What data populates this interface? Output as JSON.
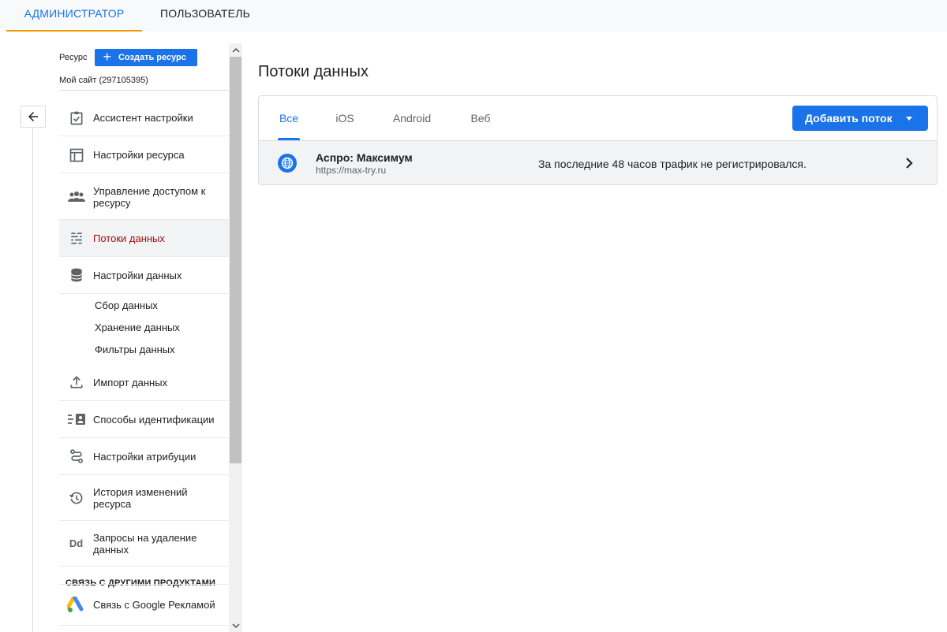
{
  "top_tabs": {
    "admin": "АДМИНИСТРАТОР",
    "user": "ПОЛЬЗОВАТЕЛЬ"
  },
  "sidebar": {
    "resource_label": "Ресурс",
    "create_button": "Создать ресурс",
    "site_name": "Мой сайт (297105395)",
    "items": [
      {
        "label": "Ассистент настройки",
        "icon": "setup-checklist-icon"
      },
      {
        "label": "Настройки ресурса",
        "icon": "property-settings-icon"
      },
      {
        "label": "Управление доступом к ресурсу",
        "icon": "people-icon"
      },
      {
        "label": "Потоки данных",
        "icon": "data-streams-icon",
        "active": true
      },
      {
        "label": "Настройки данных",
        "icon": "database-icon"
      }
    ],
    "sub_items": [
      "Сбор данных",
      "Хранение данных",
      "Фильтры данных"
    ],
    "items2": [
      {
        "label": "Импорт данных",
        "icon": "upload-icon"
      },
      {
        "label": "Способы идентификации",
        "icon": "identity-icon"
      },
      {
        "label": "Настройки атрибуции",
        "icon": "attribution-icon"
      },
      {
        "label": "История изменений ресурса",
        "icon": "history-icon"
      },
      {
        "label": "Запросы на удаление данных",
        "icon": "data-deletion-icon",
        "icon_text": "Dd"
      }
    ],
    "section_heading": "СВЯЗЬ С ДРУГИМИ ПРОДУКТАМИ",
    "google_ads_link": "Связь с Google Рекламой"
  },
  "main": {
    "title": "Потоки данных",
    "tabs": [
      "Все",
      "iOS",
      "Android",
      "Веб"
    ],
    "active_tab": "Все",
    "add_button": "Добавить поток",
    "stream": {
      "name": "Аспро: Максимум",
      "url": "https://max-try.ru",
      "status": "За последние 48 часов трафик не регистрировался."
    }
  },
  "colors": {
    "accent": "#1a73e8",
    "active_nav_text": "#a50e0e",
    "admin_tab_underline": "#f29900"
  }
}
